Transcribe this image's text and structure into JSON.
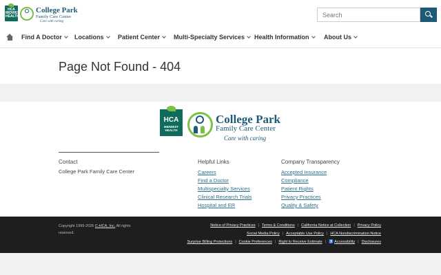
{
  "header": {
    "logo": {
      "hca": "HCA MIDWEST HEALTH",
      "name": "College Park",
      "subtitle": "Family Care Center",
      "tagline": "Care with caring"
    },
    "search": {
      "placeholder": "Search"
    }
  },
  "nav": {
    "items": [
      {
        "label": "Find A Doctor"
      },
      {
        "label": "Locations"
      },
      {
        "label": "Patient Center"
      },
      {
        "label": "Multi-Specialty Services"
      },
      {
        "label": "Health Information"
      },
      {
        "label": "About Us"
      }
    ]
  },
  "main": {
    "title": "Page Not Found - 404"
  },
  "footer": {
    "logo": {
      "hca_top": "HCA",
      "hca_bottom": "MIDWEST HEALTH",
      "name": "College Park",
      "subtitle": "Family Care Center",
      "tagline": "Care with caring"
    },
    "contact": {
      "heading": "Contact",
      "name": "College Park Family Care Center"
    },
    "helpful": {
      "heading": "Helpful Links",
      "links": [
        "Careers",
        "Find a Doctor",
        "Multispecialty Services",
        "Clinical Research Trials",
        "Hospital and ER"
      ]
    },
    "transparency": {
      "heading": "Company Transparency",
      "links": [
        "Accepted Insurance",
        "Compliance",
        "Patient Rights",
        "Privacy Practices",
        "Quality & Safety"
      ]
    }
  },
  "bottom": {
    "copyright_prefix": "Copyright 1999-2026",
    "copyright_link": "C-HCA, Inc.",
    "copyright_suffix": "All rights reserved.",
    "row1": [
      "Notice of Privacy Practices",
      "Terms & Conditions",
      "California Notice at Collection",
      "Privacy Policy"
    ],
    "row2": [
      "Social Media Policy",
      "Acceptable Use Policy",
      "HCA Nondiscrimination Notice"
    ],
    "row3": [
      "Surprise Billing Protections",
      "Cookie Preferences",
      "Right to Receive Estimate",
      "Accessibility",
      "Disclosures"
    ]
  }
}
